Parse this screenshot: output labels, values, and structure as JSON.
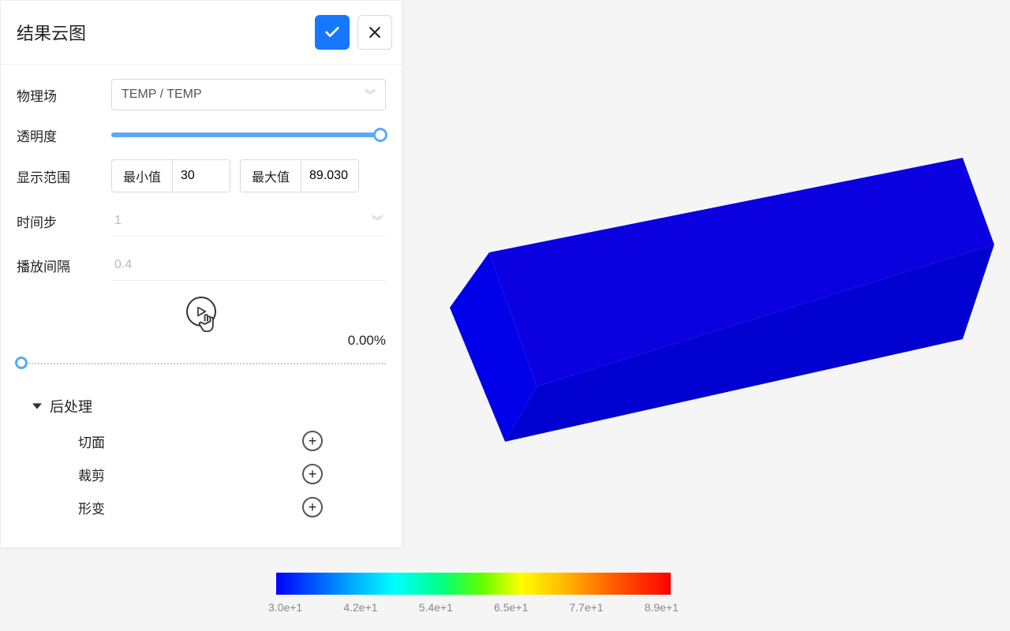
{
  "panel": {
    "title": "结果云图",
    "fields": {
      "physics_label": "物理场",
      "physics_value": "TEMP / TEMP",
      "opacity_label": "透明度",
      "range_label": "显示范围",
      "min_label": "最小值",
      "min_value": "30",
      "max_label": "最大值",
      "max_value": "89.030",
      "timestep_label": "时间步",
      "timestep_value": "1",
      "interval_label": "播放间隔",
      "interval_value": "0.4"
    },
    "playback": {
      "percent": "0.00%"
    },
    "tree": {
      "parent": "后处理",
      "children": [
        "切面",
        "裁剪",
        "形变"
      ]
    }
  },
  "colorbar": {
    "ticks": [
      "3.0e+1",
      "4.2e+1",
      "5.4e+1",
      "6.5e+1",
      "7.7e+1",
      "8.9e+1"
    ]
  },
  "chart_data": {
    "type": "heatmap",
    "title": "结果云图",
    "field": "TEMP / TEMP",
    "value_range": [
      30,
      89.03
    ],
    "current_uniform_value": 30,
    "colorbar_ticks": [
      30,
      42,
      54,
      65,
      77,
      89
    ],
    "colormap": "jet"
  }
}
